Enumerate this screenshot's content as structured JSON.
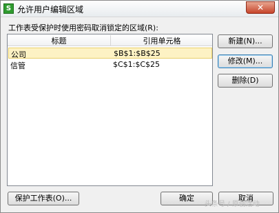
{
  "window": {
    "title": "允许用户编辑区域",
    "app_icon": "S",
    "close_label": "✕"
  },
  "prompt": "工作表受保护时使用密码取消锁定的区域(R):",
  "table": {
    "headers": [
      "标题",
      "引用单元格"
    ],
    "rows": [
      {
        "title": "公司",
        "ref": "$B$1:$B$25"
      },
      {
        "title": "信管",
        "ref": "$C$1:$C$25"
      }
    ]
  },
  "buttons": {
    "new": "新建(N)...",
    "modify": "修改(M)...",
    "delete": "删除(D)",
    "protect_sheet": "保护工作表(O)...",
    "ok": "确定",
    "cancel": "取消"
  },
  "watermark": "头条号 / 原创活动"
}
